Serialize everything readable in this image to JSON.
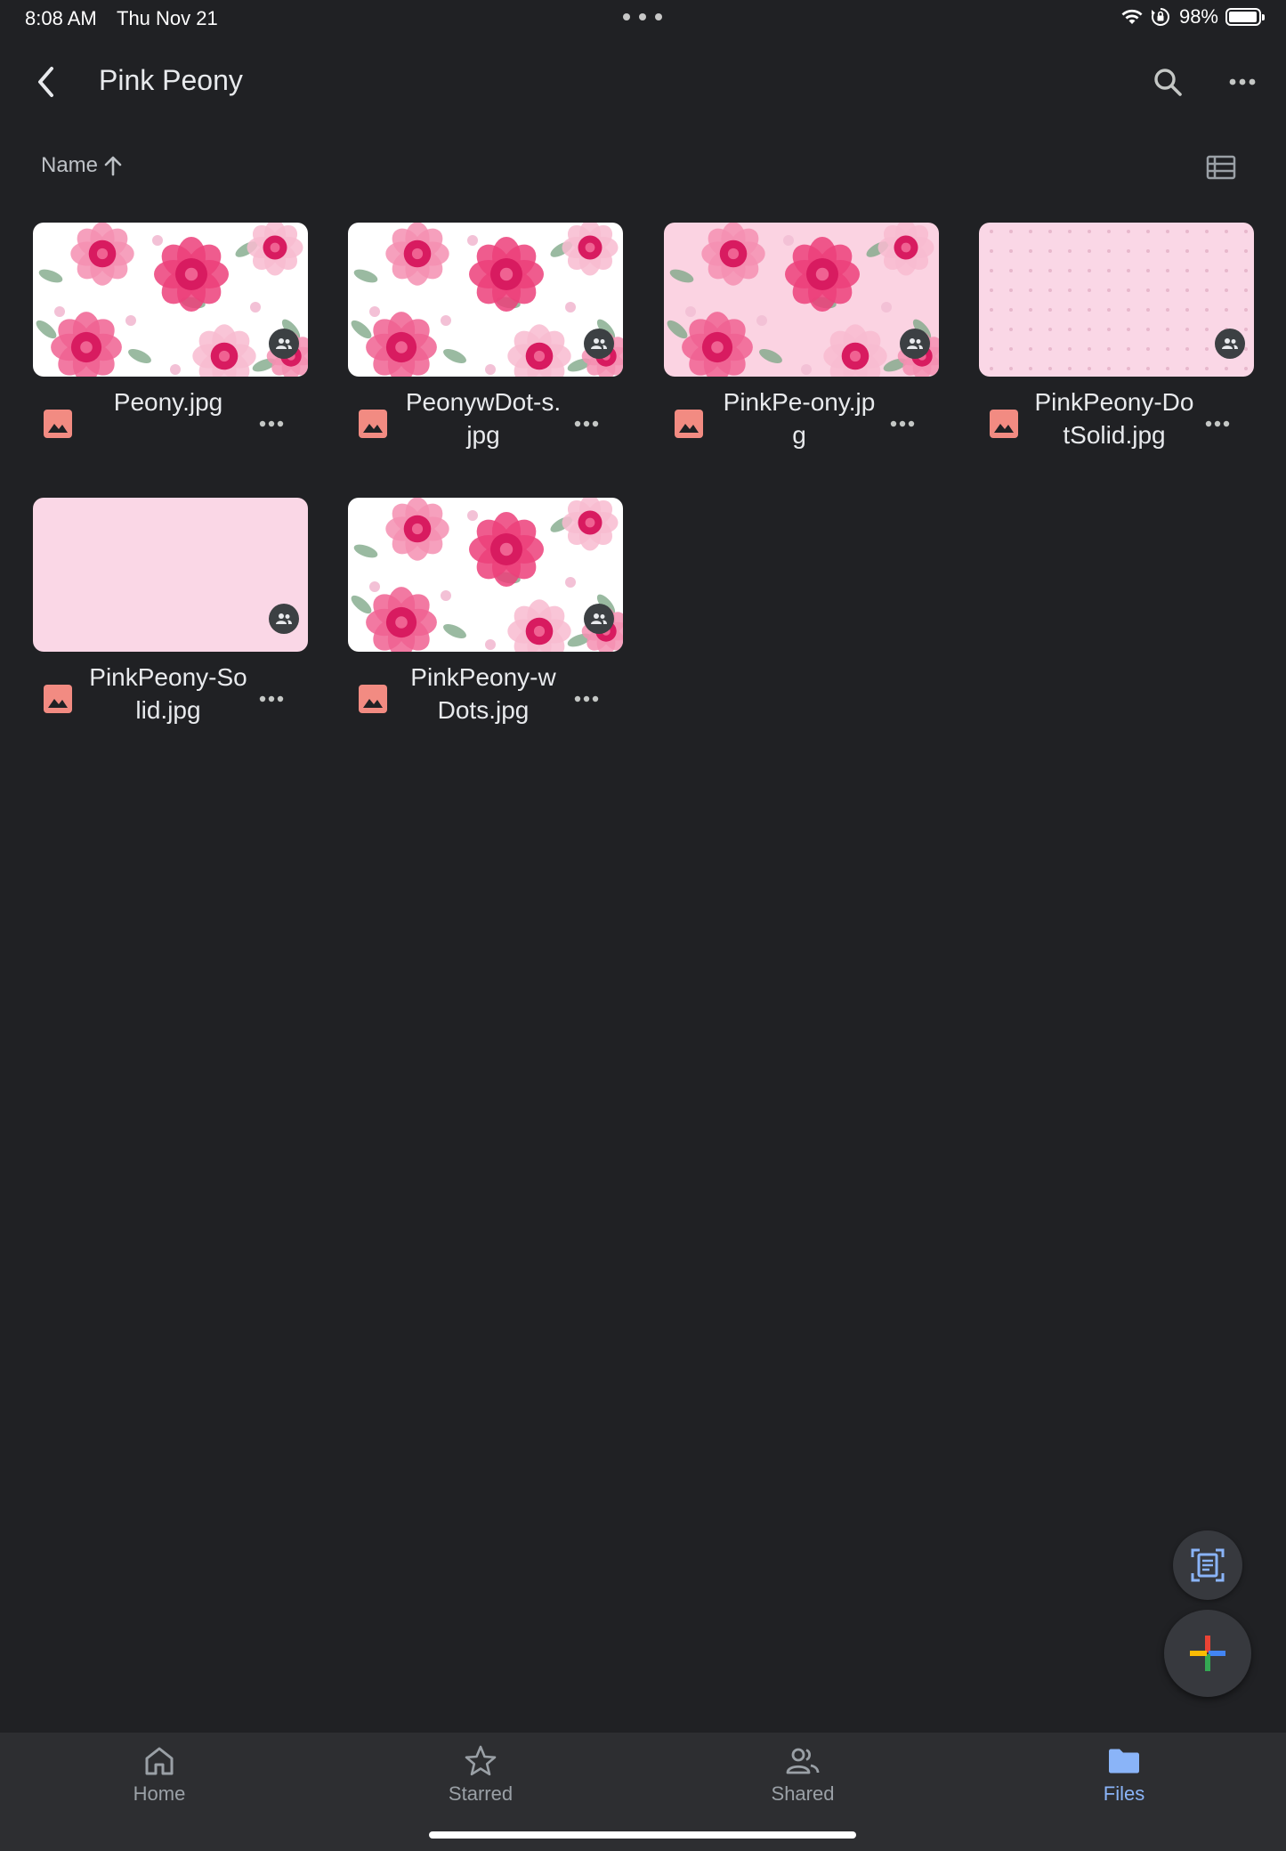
{
  "status_bar": {
    "time": "8:08 AM",
    "date": "Thu Nov 21",
    "battery_text": "98%",
    "battery_level": 0.98
  },
  "header": {
    "title": "Pink Peony",
    "back_icon": "chevron-left-icon",
    "search_icon": "search-icon",
    "more_icon": "more-horizontal-icon"
  },
  "sort": {
    "label": "Name",
    "direction_icon": "arrow-up-icon",
    "view_icon": "list-view-icon"
  },
  "files": [
    {
      "name": "Peony.jpg",
      "pattern": "floral-white",
      "shared": true
    },
    {
      "name": "PeonywDot-s.jpg",
      "pattern": "floral-white",
      "shared": true
    },
    {
      "name": "PinkPe-ony.jpg",
      "pattern": "floral-pink",
      "shared": true
    },
    {
      "name": "PinkPeony-DotSolid.jpg",
      "pattern": "dots-pink",
      "shared": true
    },
    {
      "name": "PinkPeony-Solid.jpg",
      "pattern": "solid-pink",
      "shared": true
    },
    {
      "name": "PinkPeony-wDots.jpg",
      "pattern": "floral-white",
      "shared": true
    }
  ],
  "colors": {
    "background": "#202124",
    "image_icon": "#f28b82",
    "active_tab": "#8ab4f8",
    "inactive_tab": "#9aa0a6",
    "pink_solid": "#fad7e6",
    "peony_deep": "#d81b60",
    "peony_light": "#f8bbd0",
    "leaf": "#81a98a"
  },
  "fab": {
    "scan_icon": "document-scan-icon",
    "new_icon": "plus-multicolor-icon"
  },
  "bottom_nav": [
    {
      "label": "Home",
      "icon": "home-icon",
      "active": false
    },
    {
      "label": "Starred",
      "icon": "star-icon",
      "active": false
    },
    {
      "label": "Shared",
      "icon": "people-icon",
      "active": false
    },
    {
      "label": "Files",
      "icon": "folder-icon",
      "active": true
    }
  ]
}
